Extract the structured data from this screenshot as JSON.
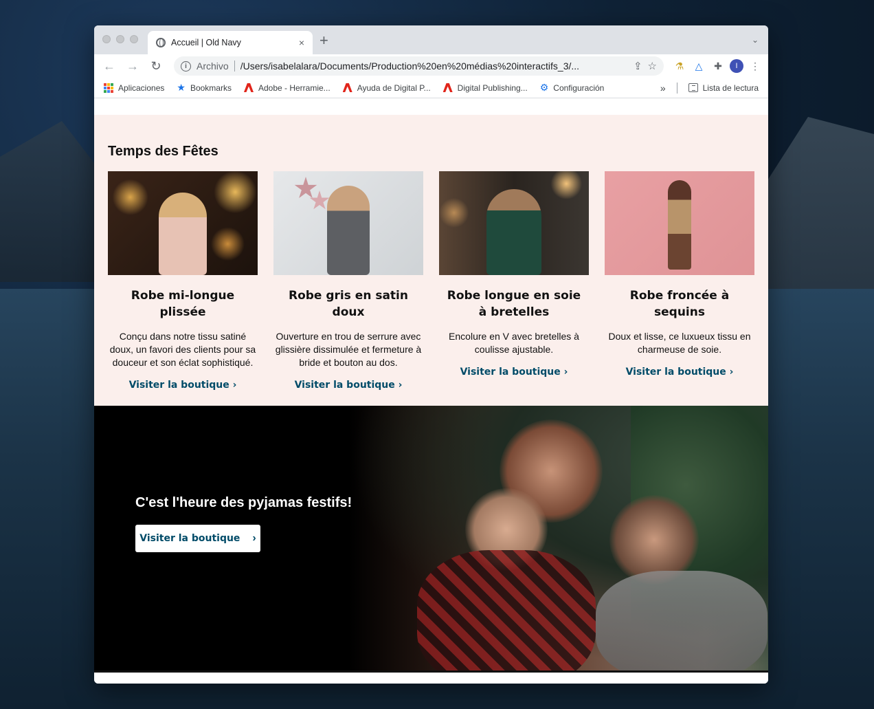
{
  "browser": {
    "tab_title": "Accueil | Old Navy",
    "new_tab": "+",
    "close": "×",
    "url_scheme": "Archivo",
    "url": "/Users/isabelalara/Documents/Production%20en%20médias%20interactifs_3/...",
    "avatar_letter": "I",
    "bookmarks": [
      {
        "label": "Aplicaciones",
        "icon": "apps-icon"
      },
      {
        "label": "Bookmarks",
        "icon": "star-icon"
      },
      {
        "label": "Adobe - Herramie...",
        "icon": "adobe-icon"
      },
      {
        "label": "Ayuda de Digital P...",
        "icon": "adobe-icon"
      },
      {
        "label": "Digital Publishing...",
        "icon": "adobe-icon"
      },
      {
        "label": "Configuración",
        "icon": "gear-icon"
      }
    ],
    "more": "»",
    "reading_list": "Lista de lectura"
  },
  "holiday": {
    "title": "Temps des Fêtes",
    "cards": [
      {
        "name": "Robe mi-longue plissée",
        "desc": "Conçu dans notre tissu satiné doux, un favori des clients pour sa douceur et son éclat sophistiqué.",
        "link": "Visiter la boutique ›"
      },
      {
        "name": "Robe gris en satin doux",
        "desc": "Ouverture en trou de serrure avec glissière dissimulée et fermeture à bride et bouton au dos.",
        "link": "Visiter la boutique ›"
      },
      {
        "name": "Robe longue en soie à bretelles",
        "desc": "Encolure en V avec bretelles à coulisse ajustable.",
        "link": "Visiter la boutique ›"
      },
      {
        "name": "Robe froncée à sequins",
        "desc": "Doux et lisse, ce luxueux tissu en charmeuse de soie.",
        "link": "Visiter la boutique ›"
      }
    ]
  },
  "pajamas": {
    "headline": "C'est l'heure des pyjamas festifs!",
    "button": "Visiter la boutique",
    "chevron": "›"
  },
  "colors": {
    "brand_link": "#004b68",
    "section_bg": "#fbefec"
  }
}
